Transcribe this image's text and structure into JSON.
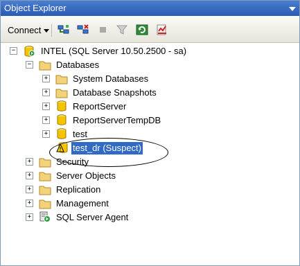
{
  "panel": {
    "title": "Object Explorer"
  },
  "toolbar": {
    "connect_label": "Connect"
  },
  "tree": {
    "server": "INTEL (SQL Server 10.50.2500 - sa)",
    "databases": "Databases",
    "system_databases": "System Databases",
    "database_snapshots": "Database Snapshots",
    "report_server": "ReportServer",
    "report_server_temp": "ReportServerTempDB",
    "test": "test",
    "test_dr": "test_dr (Suspect)",
    "security": "Security",
    "server_objects": "Server Objects",
    "replication": "Replication",
    "management": "Management",
    "agent": "SQL Server Agent"
  },
  "colors": {
    "title_bar": "#2a5ab5",
    "selection": "#316ac5",
    "folder": "#f3d27a",
    "db": "#f5c400"
  }
}
